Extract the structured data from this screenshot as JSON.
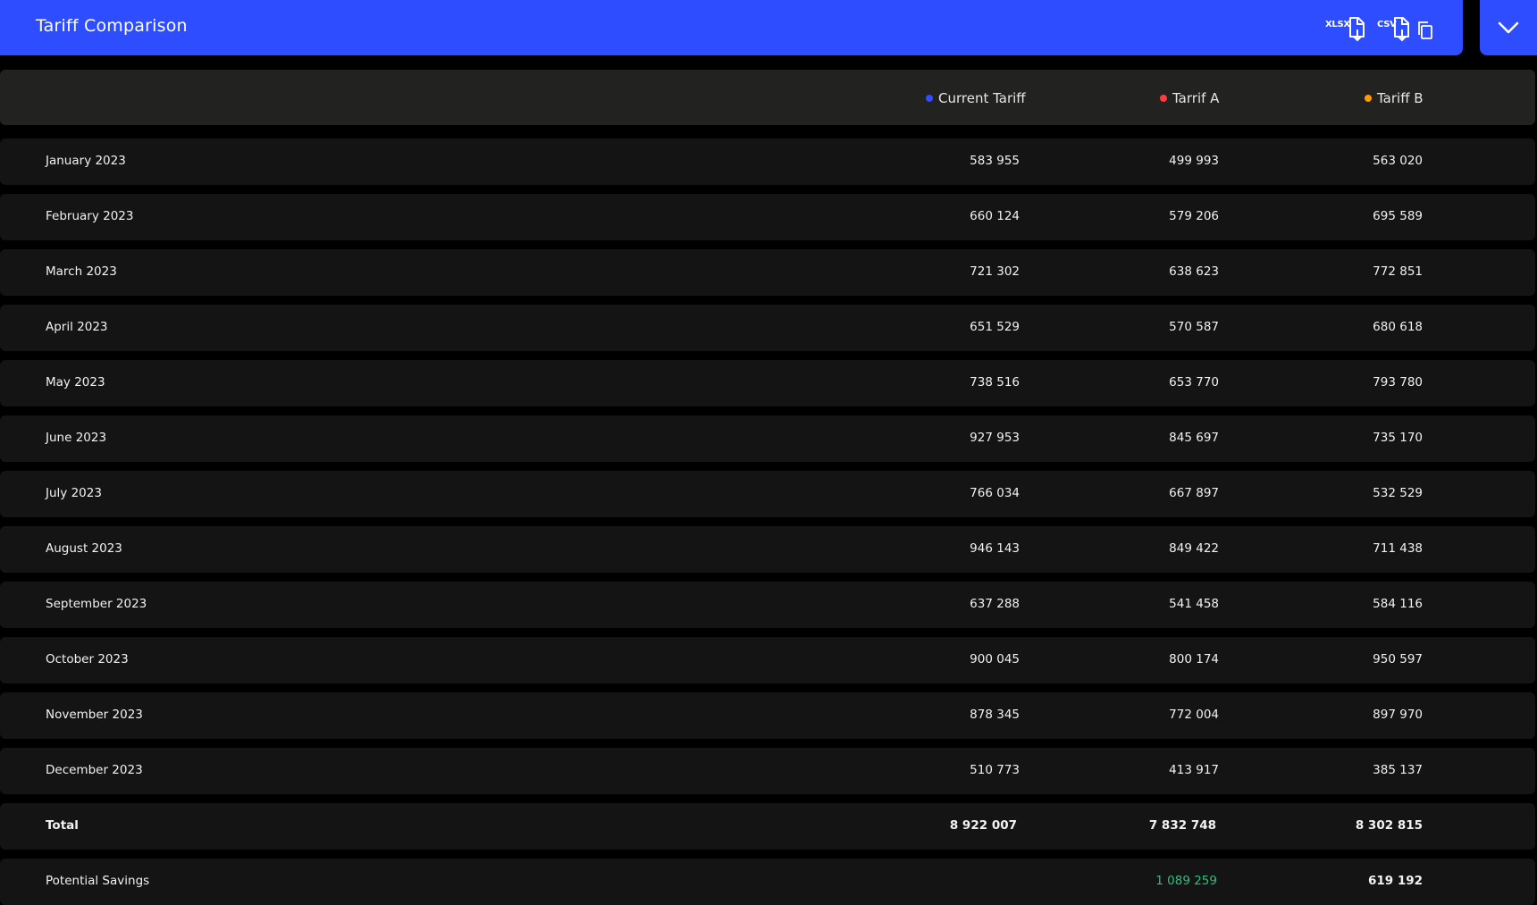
{
  "header": {
    "title": "Tariff Comparison",
    "xlsx_label": "XLSX",
    "csv_label": "CSV",
    "accent_color": "#2d4dff"
  },
  "table": {
    "columns": [
      {
        "label": "Current Tariff",
        "color": "#2d4dff"
      },
      {
        "label": "Tarrif A",
        "color": "#ff3b3b"
      },
      {
        "label": "Tariff B",
        "color": "#ff9900"
      }
    ],
    "rows": [
      {
        "label": "January 2023",
        "current": "583 955",
        "a": "499 993",
        "b": "563 020"
      },
      {
        "label": "February 2023",
        "current": "660 124",
        "a": "579 206",
        "b": "695 589"
      },
      {
        "label": "March 2023",
        "current": "721 302",
        "a": "638 623",
        "b": "772 851"
      },
      {
        "label": "April 2023",
        "current": "651 529",
        "a": "570 587",
        "b": "680 618"
      },
      {
        "label": "May 2023",
        "current": "738 516",
        "a": "653 770",
        "b": "793 780"
      },
      {
        "label": "June 2023",
        "current": "927 953",
        "a": "845 697",
        "b": "735 170"
      },
      {
        "label": "July 2023",
        "current": "766 034",
        "a": "667 897",
        "b": "532 529"
      },
      {
        "label": "August 2023",
        "current": "946 143",
        "a": "849 422",
        "b": "711 438"
      },
      {
        "label": "September 2023",
        "current": "637 288",
        "a": "541 458",
        "b": "584 116"
      },
      {
        "label": "October 2023",
        "current": "900 045",
        "a": "800 174",
        "b": "950 597"
      },
      {
        "label": "November 2023",
        "current": "878 345",
        "a": "772 004",
        "b": "897 970"
      },
      {
        "label": "December 2023",
        "current": "510 773",
        "a": "413 917",
        "b": "385 137"
      }
    ],
    "total": {
      "label": "Total",
      "current": "8 922 007",
      "a": "7 832 748",
      "b": "8 302 815"
    },
    "savings": {
      "label": "Potential Savings",
      "current": "",
      "a": "1 089 259",
      "b": "619 192",
      "a_color": "#2fbf7f"
    }
  },
  "icons": {
    "xlsx": "file-download-icon",
    "csv": "file-download-icon",
    "copy": "copy-icon",
    "collapse": "chevron-down-icon"
  }
}
